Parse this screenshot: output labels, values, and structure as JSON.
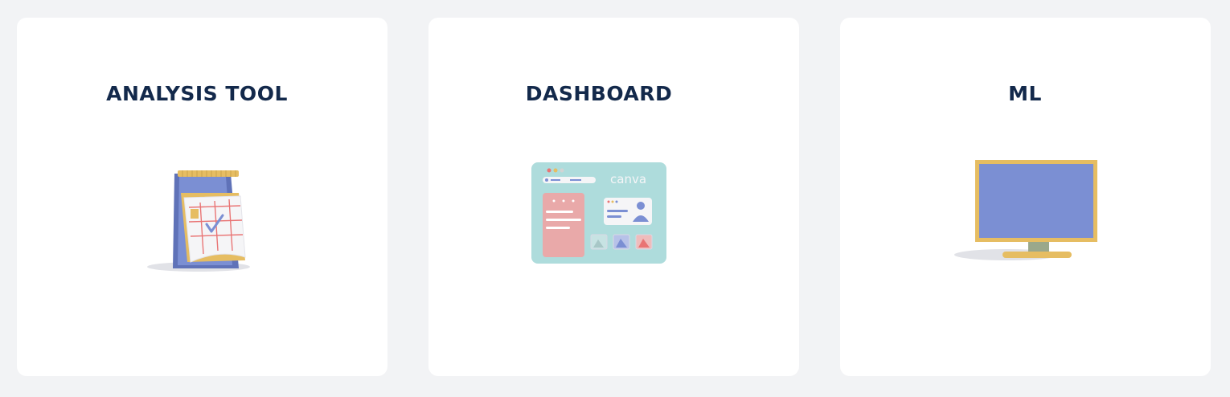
{
  "cards": [
    {
      "title": "ANALYSIS TOOL",
      "icon": "calendar-checklist-icon"
    },
    {
      "title": "DASHBOARD",
      "icon": "dashboard-browser-icon",
      "illustration_text": "canva"
    },
    {
      "title": "ML",
      "icon": "monitor-icon"
    }
  ],
  "colors": {
    "background": "#f2f3f5",
    "card": "#ffffff",
    "title": "#13294b",
    "accent_blue": "#7b8fd3",
    "accent_yellow": "#e6bd62",
    "accent_red": "#e97474",
    "accent_teal": "#aedcdc"
  }
}
